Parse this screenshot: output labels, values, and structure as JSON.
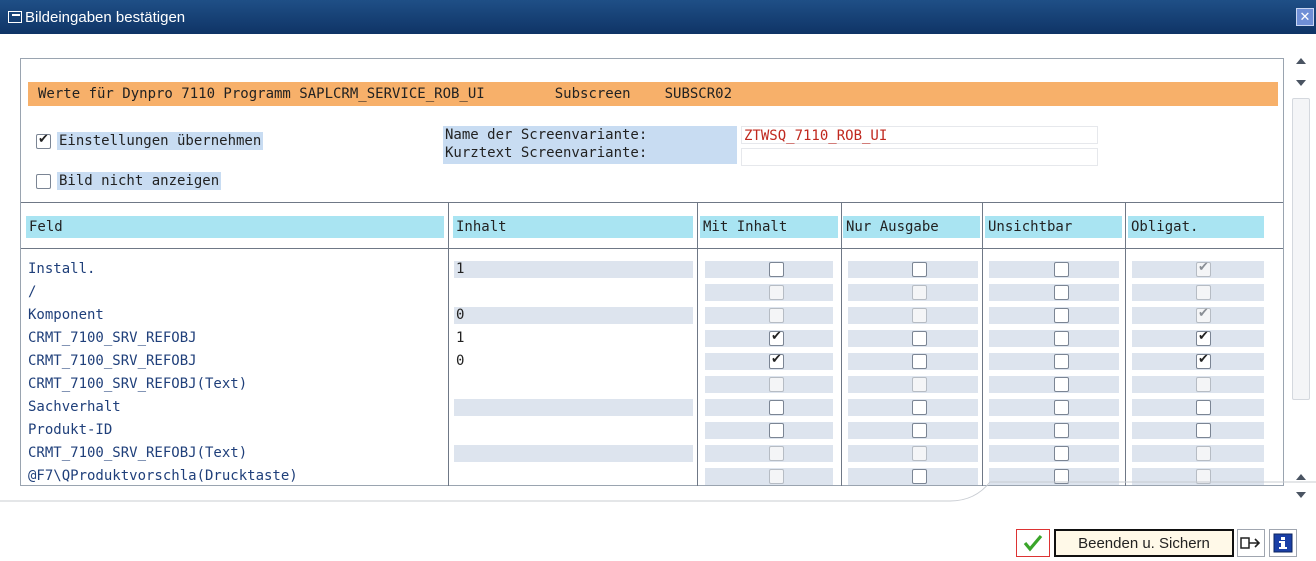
{
  "window": {
    "title": "Bildeingaben bestätigen"
  },
  "header_bar": {
    "part1": "Werte für Dynpro 7110 Programm SAPLCRM_SERVICE_ROB_UI",
    "part2": "Subscreen",
    "part3": "SUBSCR02"
  },
  "options": {
    "uebernehmen": {
      "label": "Einstellungen übernehmen",
      "checked": true
    },
    "nicht_anzeigen": {
      "label": "Bild nicht anzeigen",
      "checked": false
    }
  },
  "variant": {
    "name_label": "Name der Screenvariante:",
    "name_value": "ZTWSQ_7110_ROB_UI",
    "kurz_label": "Kurztext Screenvariante:",
    "kurz_value": ""
  },
  "table": {
    "headers": [
      "Feld",
      "Inhalt",
      "Mit Inhalt",
      "Nur Ausgabe",
      "Unsichtbar",
      "Obligat."
    ],
    "rows": [
      {
        "feld": "Install.",
        "inhalt": "1",
        "mit": "unchecked",
        "nur": "unchecked",
        "uns": "unchecked",
        "obl": "checked-disabled",
        "inhalt_field": true
      },
      {
        "feld": "/",
        "inhalt": "",
        "mit": "disabled",
        "nur": "disabled",
        "uns": "unchecked",
        "obl": "disabled",
        "inhalt_field": false
      },
      {
        "feld": "Komponent",
        "inhalt": "0",
        "mit": "disabled",
        "nur": "disabled",
        "uns": "unchecked",
        "obl": "checked-disabled",
        "inhalt_field": true
      },
      {
        "feld": "CRMT_7100_SRV_REFOBJ",
        "inhalt": "1",
        "mit": "checked",
        "nur": "unchecked",
        "uns": "unchecked",
        "obl": "checked",
        "inhalt_field": false
      },
      {
        "feld": "CRMT_7100_SRV_REFOBJ",
        "inhalt": "0",
        "mit": "checked",
        "nur": "unchecked",
        "uns": "unchecked",
        "obl": "checked",
        "inhalt_field": false
      },
      {
        "feld": "CRMT_7100_SRV_REFOBJ(Text)",
        "inhalt": "",
        "mit": "disabled",
        "nur": "disabled",
        "uns": "unchecked",
        "obl": "disabled",
        "inhalt_field": false
      },
      {
        "feld": "Sachverhalt",
        "inhalt": "",
        "mit": "unchecked",
        "nur": "unchecked",
        "uns": "unchecked",
        "obl": "unchecked",
        "inhalt_field": true
      },
      {
        "feld": "Produkt-ID",
        "inhalt": "",
        "mit": "unchecked",
        "nur": "unchecked",
        "uns": "unchecked",
        "obl": "unchecked",
        "inhalt_field": false
      },
      {
        "feld": "CRMT_7100_SRV_REFOBJ(Text)",
        "inhalt": "",
        "mit": "disabled",
        "nur": "disabled",
        "uns": "unchecked",
        "obl": "disabled",
        "inhalt_field": true
      },
      {
        "feld": "@F7\\QProduktvorschla(Drucktaste)",
        "inhalt": "",
        "mit": "disabled",
        "nur": "unchecked",
        "uns": "unchecked",
        "obl": "disabled",
        "inhalt_field": false
      }
    ]
  },
  "buttons": {
    "confirm_icon": "checkmark-icon",
    "save_label": "Beenden u. Sichern",
    "transfer_icon": "transfer-icon",
    "info_icon": "info-icon"
  },
  "colors": {
    "titlebar": "#1f4f86",
    "header_bar": "#f7b06a",
    "column_header": "#a9e4f2",
    "label_highlight": "#c8dcf2",
    "variant_value": "#c0281e"
  }
}
